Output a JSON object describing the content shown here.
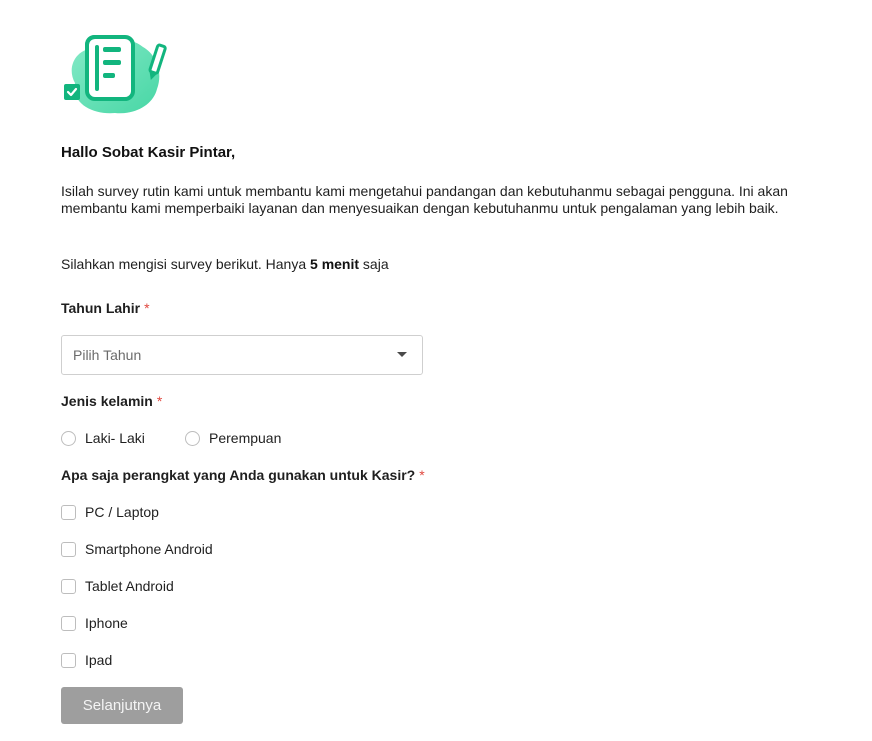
{
  "survey": {
    "greeting": "Hallo Sobat Kasir Pintar,",
    "intro": "Isilah survey rutin kami untuk membantu kami mengetahui pandangan dan kebutuhanmu sebagai pengguna. Ini akan membantu kami memperbaiki layanan dan menyesuaikan dengan kebutuhanmu untuk pengalaman yang lebih baik.",
    "note_prefix": "Silahkan mengisi survey berikut. Hanya ",
    "note_bold": "5 menit",
    "note_suffix": " saja",
    "required_mark": "*"
  },
  "questions": {
    "birth_year": {
      "label": "Tahun Lahir",
      "placeholder": "Pilih Tahun"
    },
    "gender": {
      "label": "Jenis kelamin",
      "options": [
        "Laki- Laki",
        "Perempuan"
      ]
    },
    "devices": {
      "label": "Apa saja perangkat yang Anda gunakan untuk Kasir?",
      "options": [
        "PC / Laptop",
        "Smartphone Android",
        "Tablet Android",
        "Iphone",
        "Ipad"
      ]
    }
  },
  "actions": {
    "next_label": "Selanjutnya"
  },
  "colors": {
    "brand_green": "#2ed39a",
    "required_red": "#e0483f",
    "button_disabled": "#9e9e9e"
  },
  "icons": {
    "logo": "survey-document-pencil-icon"
  }
}
